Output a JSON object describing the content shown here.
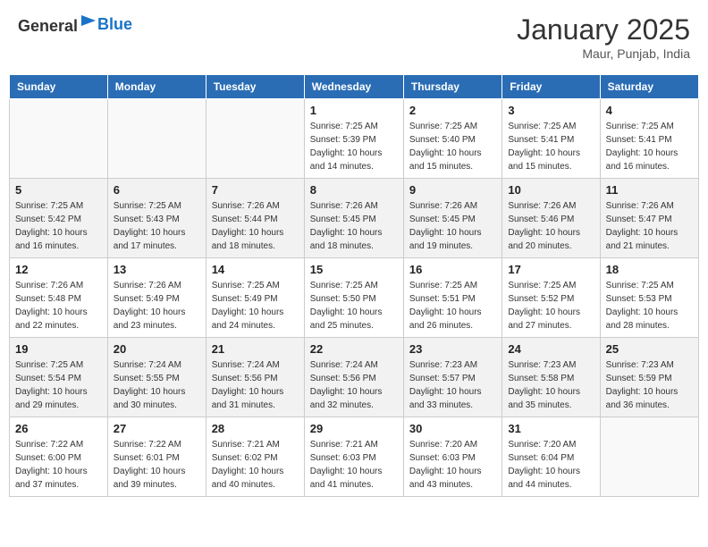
{
  "header": {
    "logo_general": "General",
    "logo_blue": "Blue",
    "title": "January 2025",
    "location": "Maur, Punjab, India"
  },
  "days_of_week": [
    "Sunday",
    "Monday",
    "Tuesday",
    "Wednesday",
    "Thursday",
    "Friday",
    "Saturday"
  ],
  "weeks": [
    {
      "shaded": false,
      "days": [
        {
          "date": "",
          "info": ""
        },
        {
          "date": "",
          "info": ""
        },
        {
          "date": "",
          "info": ""
        },
        {
          "date": "1",
          "info": "Sunrise: 7:25 AM\nSunset: 5:39 PM\nDaylight: 10 hours\nand 14 minutes."
        },
        {
          "date": "2",
          "info": "Sunrise: 7:25 AM\nSunset: 5:40 PM\nDaylight: 10 hours\nand 15 minutes."
        },
        {
          "date": "3",
          "info": "Sunrise: 7:25 AM\nSunset: 5:41 PM\nDaylight: 10 hours\nand 15 minutes."
        },
        {
          "date": "4",
          "info": "Sunrise: 7:25 AM\nSunset: 5:41 PM\nDaylight: 10 hours\nand 16 minutes."
        }
      ]
    },
    {
      "shaded": true,
      "days": [
        {
          "date": "5",
          "info": "Sunrise: 7:25 AM\nSunset: 5:42 PM\nDaylight: 10 hours\nand 16 minutes."
        },
        {
          "date": "6",
          "info": "Sunrise: 7:25 AM\nSunset: 5:43 PM\nDaylight: 10 hours\nand 17 minutes."
        },
        {
          "date": "7",
          "info": "Sunrise: 7:26 AM\nSunset: 5:44 PM\nDaylight: 10 hours\nand 18 minutes."
        },
        {
          "date": "8",
          "info": "Sunrise: 7:26 AM\nSunset: 5:45 PM\nDaylight: 10 hours\nand 18 minutes."
        },
        {
          "date": "9",
          "info": "Sunrise: 7:26 AM\nSunset: 5:45 PM\nDaylight: 10 hours\nand 19 minutes."
        },
        {
          "date": "10",
          "info": "Sunrise: 7:26 AM\nSunset: 5:46 PM\nDaylight: 10 hours\nand 20 minutes."
        },
        {
          "date": "11",
          "info": "Sunrise: 7:26 AM\nSunset: 5:47 PM\nDaylight: 10 hours\nand 21 minutes."
        }
      ]
    },
    {
      "shaded": false,
      "days": [
        {
          "date": "12",
          "info": "Sunrise: 7:26 AM\nSunset: 5:48 PM\nDaylight: 10 hours\nand 22 minutes."
        },
        {
          "date": "13",
          "info": "Sunrise: 7:26 AM\nSunset: 5:49 PM\nDaylight: 10 hours\nand 23 minutes."
        },
        {
          "date": "14",
          "info": "Sunrise: 7:25 AM\nSunset: 5:49 PM\nDaylight: 10 hours\nand 24 minutes."
        },
        {
          "date": "15",
          "info": "Sunrise: 7:25 AM\nSunset: 5:50 PM\nDaylight: 10 hours\nand 25 minutes."
        },
        {
          "date": "16",
          "info": "Sunrise: 7:25 AM\nSunset: 5:51 PM\nDaylight: 10 hours\nand 26 minutes."
        },
        {
          "date": "17",
          "info": "Sunrise: 7:25 AM\nSunset: 5:52 PM\nDaylight: 10 hours\nand 27 minutes."
        },
        {
          "date": "18",
          "info": "Sunrise: 7:25 AM\nSunset: 5:53 PM\nDaylight: 10 hours\nand 28 minutes."
        }
      ]
    },
    {
      "shaded": true,
      "days": [
        {
          "date": "19",
          "info": "Sunrise: 7:25 AM\nSunset: 5:54 PM\nDaylight: 10 hours\nand 29 minutes."
        },
        {
          "date": "20",
          "info": "Sunrise: 7:24 AM\nSunset: 5:55 PM\nDaylight: 10 hours\nand 30 minutes."
        },
        {
          "date": "21",
          "info": "Sunrise: 7:24 AM\nSunset: 5:56 PM\nDaylight: 10 hours\nand 31 minutes."
        },
        {
          "date": "22",
          "info": "Sunrise: 7:24 AM\nSunset: 5:56 PM\nDaylight: 10 hours\nand 32 minutes."
        },
        {
          "date": "23",
          "info": "Sunrise: 7:23 AM\nSunset: 5:57 PM\nDaylight: 10 hours\nand 33 minutes."
        },
        {
          "date": "24",
          "info": "Sunrise: 7:23 AM\nSunset: 5:58 PM\nDaylight: 10 hours\nand 35 minutes."
        },
        {
          "date": "25",
          "info": "Sunrise: 7:23 AM\nSunset: 5:59 PM\nDaylight: 10 hours\nand 36 minutes."
        }
      ]
    },
    {
      "shaded": false,
      "days": [
        {
          "date": "26",
          "info": "Sunrise: 7:22 AM\nSunset: 6:00 PM\nDaylight: 10 hours\nand 37 minutes."
        },
        {
          "date": "27",
          "info": "Sunrise: 7:22 AM\nSunset: 6:01 PM\nDaylight: 10 hours\nand 39 minutes."
        },
        {
          "date": "28",
          "info": "Sunrise: 7:21 AM\nSunset: 6:02 PM\nDaylight: 10 hours\nand 40 minutes."
        },
        {
          "date": "29",
          "info": "Sunrise: 7:21 AM\nSunset: 6:03 PM\nDaylight: 10 hours\nand 41 minutes."
        },
        {
          "date": "30",
          "info": "Sunrise: 7:20 AM\nSunset: 6:03 PM\nDaylight: 10 hours\nand 43 minutes."
        },
        {
          "date": "31",
          "info": "Sunrise: 7:20 AM\nSunset: 6:04 PM\nDaylight: 10 hours\nand 44 minutes."
        },
        {
          "date": "",
          "info": ""
        }
      ]
    }
  ]
}
